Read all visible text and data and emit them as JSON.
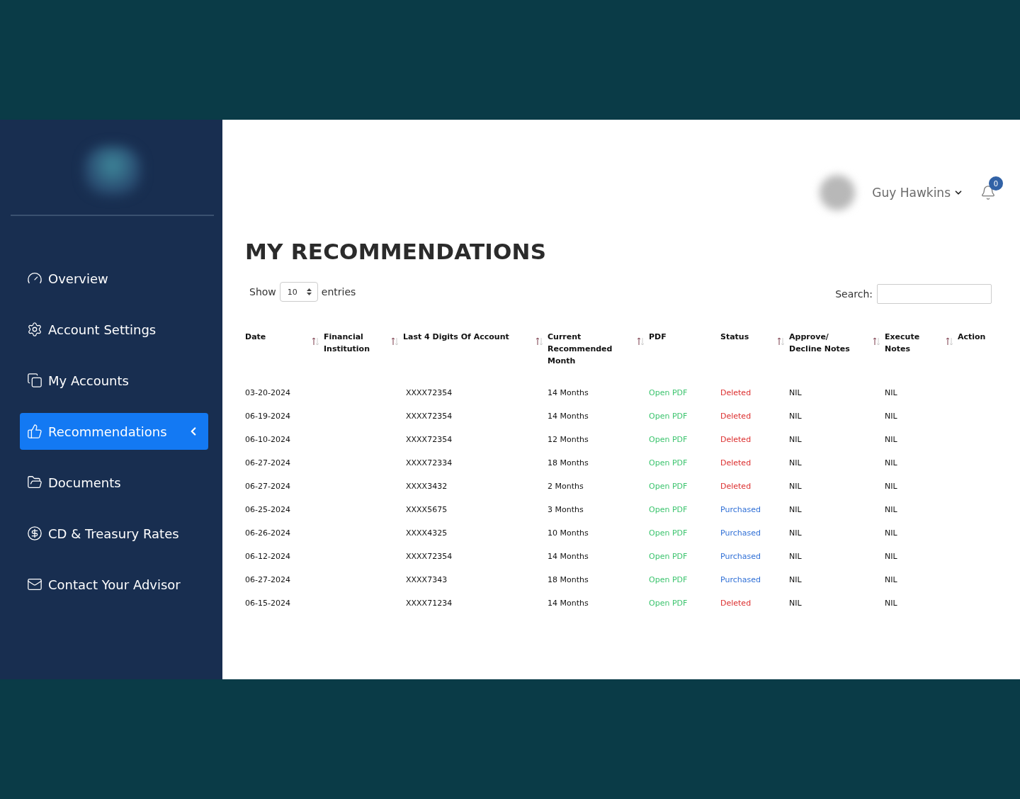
{
  "sidebar": {
    "items": [
      {
        "label": "Overview",
        "selected": false
      },
      {
        "label": "Account Settings",
        "selected": false
      },
      {
        "label": "My Accounts",
        "selected": false
      },
      {
        "label": "Recommendations",
        "selected": true
      },
      {
        "label": "Documents",
        "selected": false
      },
      {
        "label": "CD & Treasury Rates",
        "selected": false
      },
      {
        "label": "Contact Your Advisor",
        "selected": false
      }
    ]
  },
  "user": {
    "name": "Guy Hawkins",
    "notifications": "0"
  },
  "page_title": "MY RECOMMENDATIONS",
  "length_menu": {
    "before": "Show",
    "value": "10",
    "after": "entries"
  },
  "search": {
    "label": "Search:"
  },
  "table": {
    "columns": [
      {
        "label": "Date",
        "sortable": true
      },
      {
        "label": "Financial Institution",
        "sortable": true
      },
      {
        "label": "Last 4 Digits Of Account",
        "sortable": true
      },
      {
        "label": "Current Recommended Month",
        "sortable": true
      },
      {
        "label": "PDF",
        "sortable": false
      },
      {
        "label": "Status",
        "sortable": true
      },
      {
        "label": "Approve/ Decline Notes",
        "sortable": true
      },
      {
        "label": "Execute Notes",
        "sortable": true
      },
      {
        "label": "Action",
        "sortable": false
      }
    ],
    "rows": [
      {
        "date": "03-20-2024",
        "account": "XXXX72354",
        "month": "14 Months",
        "pdf": "Open PDF",
        "status": {
          "text": "Deleted",
          "kind": "deleted"
        },
        "approve_notes": "NIL",
        "execute_notes": "NIL"
      },
      {
        "date": "06-19-2024",
        "account": "XXXX72354",
        "month": "14 Months",
        "pdf": "Open PDF",
        "status": {
          "text": "Deleted",
          "kind": "deleted"
        },
        "approve_notes": "NIL",
        "execute_notes": "NIL"
      },
      {
        "date": "06-10-2024",
        "account": "XXXX72354",
        "month": "12 Months",
        "pdf": "Open PDF",
        "status": {
          "text": "Deleted",
          "kind": "deleted"
        },
        "approve_notes": "NIL",
        "execute_notes": "NIL"
      },
      {
        "date": "06-27-2024",
        "account": "XXXX72334",
        "month": "18 Months",
        "pdf": "Open PDF",
        "status": {
          "text": "Deleted",
          "kind": "deleted"
        },
        "approve_notes": "NIL",
        "execute_notes": "NIL"
      },
      {
        "date": "06-27-2024",
        "account": "XXXX3432",
        "month": "2 Months",
        "pdf": "Open PDF",
        "status": {
          "text": "Deleted",
          "kind": "deleted"
        },
        "approve_notes": "NIL",
        "execute_notes": "NIL"
      },
      {
        "date": "06-25-2024",
        "account": "XXXX5675",
        "month": "3 Months",
        "pdf": "Open PDF",
        "status": {
          "text": "Purchased",
          "kind": "purchased"
        },
        "approve_notes": "NIL",
        "execute_notes": "NIL"
      },
      {
        "date": "06-26-2024",
        "account": "XXXX4325",
        "month": "10 Months",
        "pdf": "Open PDF",
        "status": {
          "text": "Purchased",
          "kind": "purchased"
        },
        "approve_notes": "NIL",
        "execute_notes": "NIL"
      },
      {
        "date": "06-12-2024",
        "account": "XXXX72354",
        "month": "14 Months",
        "pdf": "Open PDF",
        "status": {
          "text": "Purchased",
          "kind": "purchased"
        },
        "approve_notes": "NIL",
        "execute_notes": "NIL"
      },
      {
        "date": "06-27-2024",
        "account": "XXXX7343",
        "month": "18 Months",
        "pdf": "Open PDF",
        "status": {
          "text": "Purchased",
          "kind": "purchased"
        },
        "approve_notes": "NIL",
        "execute_notes": "NIL"
      },
      {
        "date": "06-15-2024",
        "account": "XXXX71234",
        "month": "14 Months",
        "pdf": "Open PDF",
        "status": {
          "text": "Deleted",
          "kind": "deleted"
        },
        "approve_notes": "NIL",
        "execute_notes": "NIL"
      }
    ]
  }
}
